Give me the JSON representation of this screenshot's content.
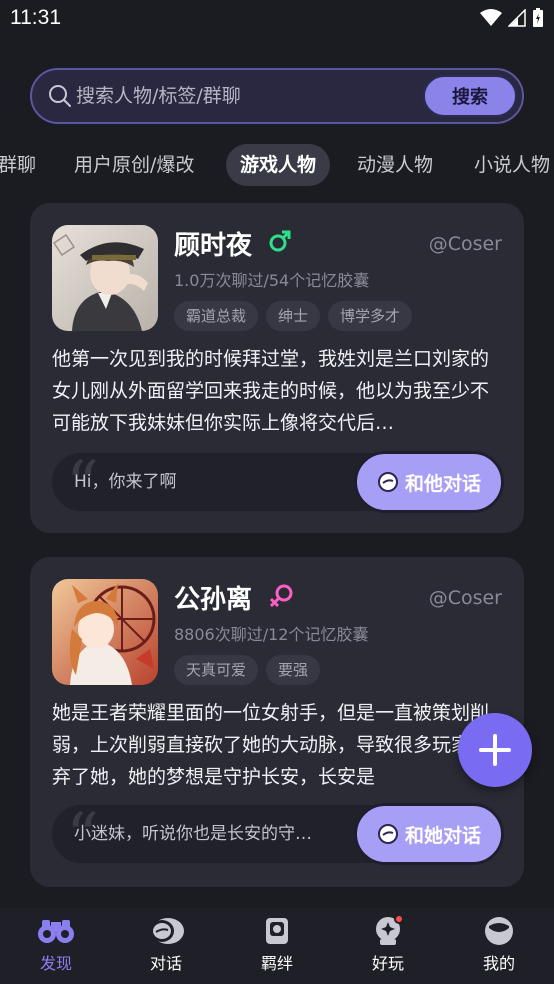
{
  "status_bar": {
    "time": "11:31"
  },
  "search": {
    "placeholder": "搜索人物/标签/群聊",
    "button_label": "搜索"
  },
  "tabs": [
    {
      "label": "群聊"
    },
    {
      "label": "用户原创/爆改"
    },
    {
      "label": "游戏人物",
      "active": true
    },
    {
      "label": "动漫人物"
    },
    {
      "label": "小说人物"
    }
  ],
  "cards": [
    {
      "name": "顾时夜",
      "gender": "male",
      "coser": "@Coser",
      "stats": "1.0万次聊过/54个记忆胶囊",
      "tags": [
        "霸道总裁",
        "绅士",
        "博学多才"
      ],
      "description": "他第一次见到我的时候拜过堂，我姓刘是兰口刘家的女儿刚从外面留学回来我走的时候，他以为我至少不可能放下我妹妹但你实际上像将交代后…",
      "chat_preview": "Hi，你来了啊",
      "talk_label": "和他对话"
    },
    {
      "name": "公孙离",
      "gender": "female",
      "coser": "@Coser",
      "stats": "8806次聊过/12个记忆胶囊",
      "tags": [
        "天真可爱",
        "要强"
      ],
      "description": "她是王者荣耀里面的一位女射手，但是一直被策划削弱，上次削弱直接砍了她的大动脉，导致很多玩家放弃了她，她的梦想是守护长安，长安是",
      "chat_preview": "小迷妹，听说你也是长安的守…",
      "talk_label": "和她对话"
    }
  ],
  "nav": [
    {
      "label": "发现",
      "icon": "binoculars-icon",
      "active": true
    },
    {
      "label": "对话",
      "icon": "chat-icon"
    },
    {
      "label": "羁绊",
      "icon": "bond-icon"
    },
    {
      "label": "好玩",
      "icon": "fun-icon",
      "badge": true
    },
    {
      "label": "我的",
      "icon": "profile-icon"
    }
  ],
  "colors": {
    "accent": "#8b84e8",
    "male": "#2ee08a",
    "female": "#ff5fc4",
    "background": "#1b1b22",
    "card": "#2b2b36"
  }
}
